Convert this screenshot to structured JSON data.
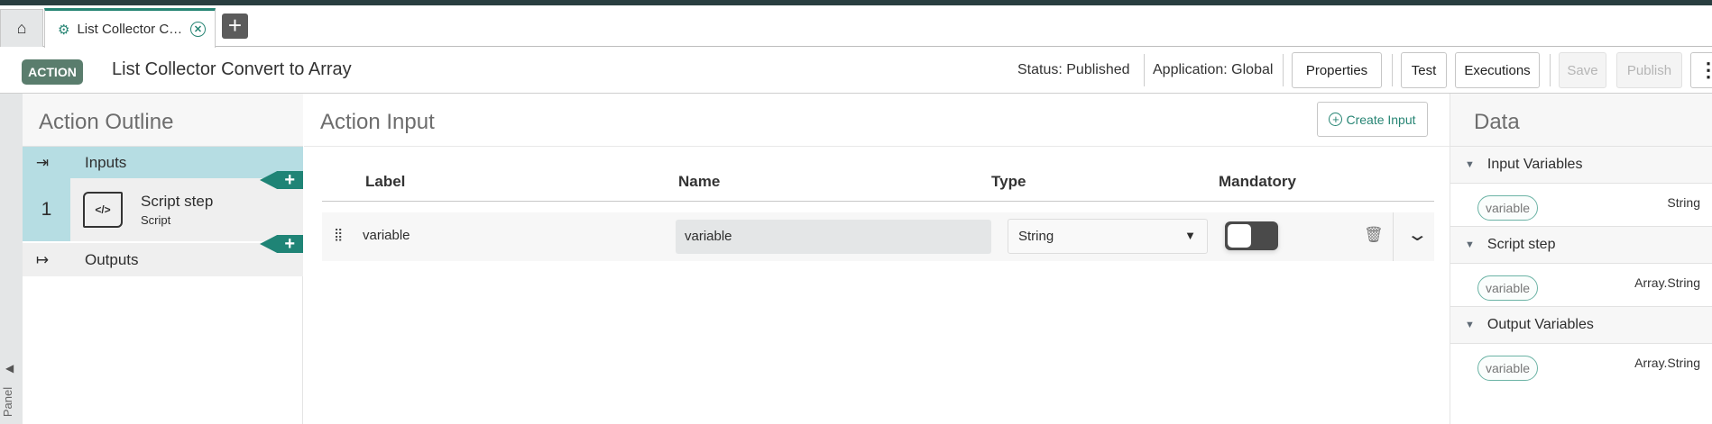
{
  "tabs": {
    "home_icon": "home-icon",
    "active_tab": {
      "label": "List Collector C…",
      "icon": "gears-icon"
    },
    "add_label": "+"
  },
  "header": {
    "badge": "ACTION",
    "title": "List Collector Convert to Array",
    "status": "Status: Published",
    "application": "Application: Global",
    "buttons": {
      "properties": "Properties",
      "test": "Test",
      "executions": "Executions",
      "save": "Save",
      "publish": "Publish",
      "more": "⋮"
    }
  },
  "side_strip": {
    "label": "Panel",
    "toggle": "◀"
  },
  "outline": {
    "title": "Action Outline",
    "inputs": "Inputs",
    "step_number": "1",
    "step_title": "Script step",
    "step_type": "Script",
    "outputs": "Outputs",
    "add": "+"
  },
  "action_input": {
    "title": "Action Input",
    "create_button": "Create Input",
    "columns": {
      "label": "Label",
      "name": "Name",
      "type": "Type",
      "mandatory": "Mandatory"
    },
    "rows": [
      {
        "label": "variable",
        "name": "variable",
        "type": "String",
        "mandatory": false
      }
    ]
  },
  "data": {
    "title": "Data",
    "sections": [
      {
        "title": "Input Variables",
        "items": [
          {
            "name": "variable",
            "type": "String"
          }
        ]
      },
      {
        "title": "Script step",
        "items": [
          {
            "name": "variable",
            "type": "Array.String"
          }
        ]
      },
      {
        "title": "Output Variables",
        "items": [
          {
            "name": "variable",
            "type": "Array.String"
          }
        ]
      }
    ]
  },
  "colors": {
    "accent": "#278574",
    "badge": "#5a7d6d",
    "outline_active": "#b6dde3"
  }
}
